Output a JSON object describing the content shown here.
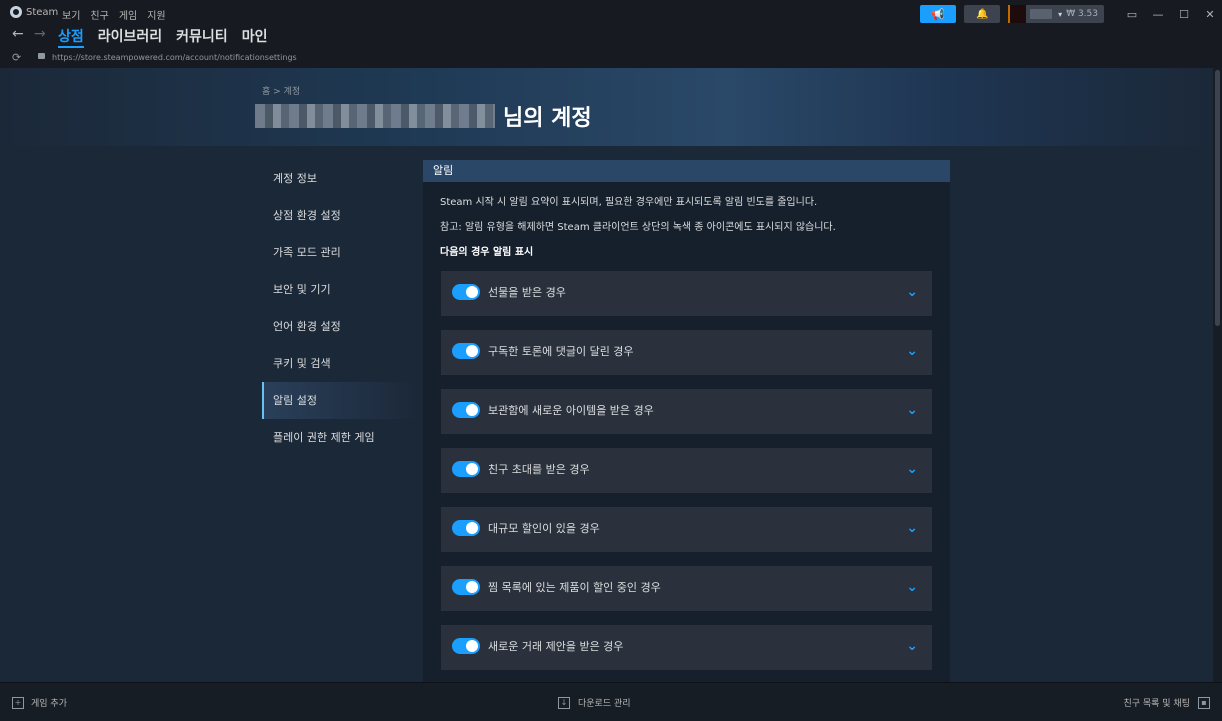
{
  "titlebar": {
    "app_name": "Steam",
    "menu": [
      "보기",
      "친구",
      "게임",
      "지원"
    ],
    "wallet": "₩ 3.53",
    "icons": [
      "steam-logo-icon",
      "megaphone-icon",
      "bell-icon",
      "monitor-icon",
      "minimize-icon",
      "maximize-icon",
      "close-icon"
    ]
  },
  "nav": {
    "tabs": [
      "상점",
      "라이브러리",
      "커뮤니티",
      "마인"
    ],
    "active_tab": "상점"
  },
  "url": "https://store.steampowered.com/account/notificationsettings",
  "header": {
    "breadcrumb": "홈 > 계정",
    "title_suffix": "님의 계정"
  },
  "sidebar": {
    "items": [
      "계정 정보",
      "상점 환경 설정",
      "가족 모드 관리",
      "보안 및 기기",
      "언어 환경 설정",
      "쿠키 및 검색",
      "알림 설정",
      "플레이 권한 제한 게임"
    ],
    "active": "알림 설정"
  },
  "panel": {
    "title": "알림",
    "desc1": "Steam 시작 시 알림 요약이 표시되며, 필요한 경우에만 표시되도록 알림 빈도를 줄입니다.",
    "desc2": "참고: 알림 유형을 해제하면 Steam 클라이언트 상단의 녹색 종 아이콘에도 표시되지 않습니다.",
    "subhead": "다음의 경우 알림 표시",
    "rows": [
      {
        "label": "선물을 받은 경우",
        "enabled": true
      },
      {
        "label": "구독한 토론에 댓글이 달린 경우",
        "enabled": true
      },
      {
        "label": "보관함에 새로운 아이템을 받은 경우",
        "enabled": true
      },
      {
        "label": "친구 초대를 받은 경우",
        "enabled": true
      },
      {
        "label": "대규모 할인이 있을 경우",
        "enabled": true
      },
      {
        "label": "찜 목록에 있는 제품이 할인 중인 경우",
        "enabled": true
      },
      {
        "label": "새로운 거래 제안을 받은 경우",
        "enabled": true
      }
    ]
  },
  "bottom": {
    "add_game": "게임 추가",
    "downloads": "다운로드 관리",
    "friends": "친구 목록 및 채팅"
  },
  "colors": {
    "accent": "#1a9fff",
    "background": "#1b2838",
    "panel_header": "#2a4768"
  }
}
